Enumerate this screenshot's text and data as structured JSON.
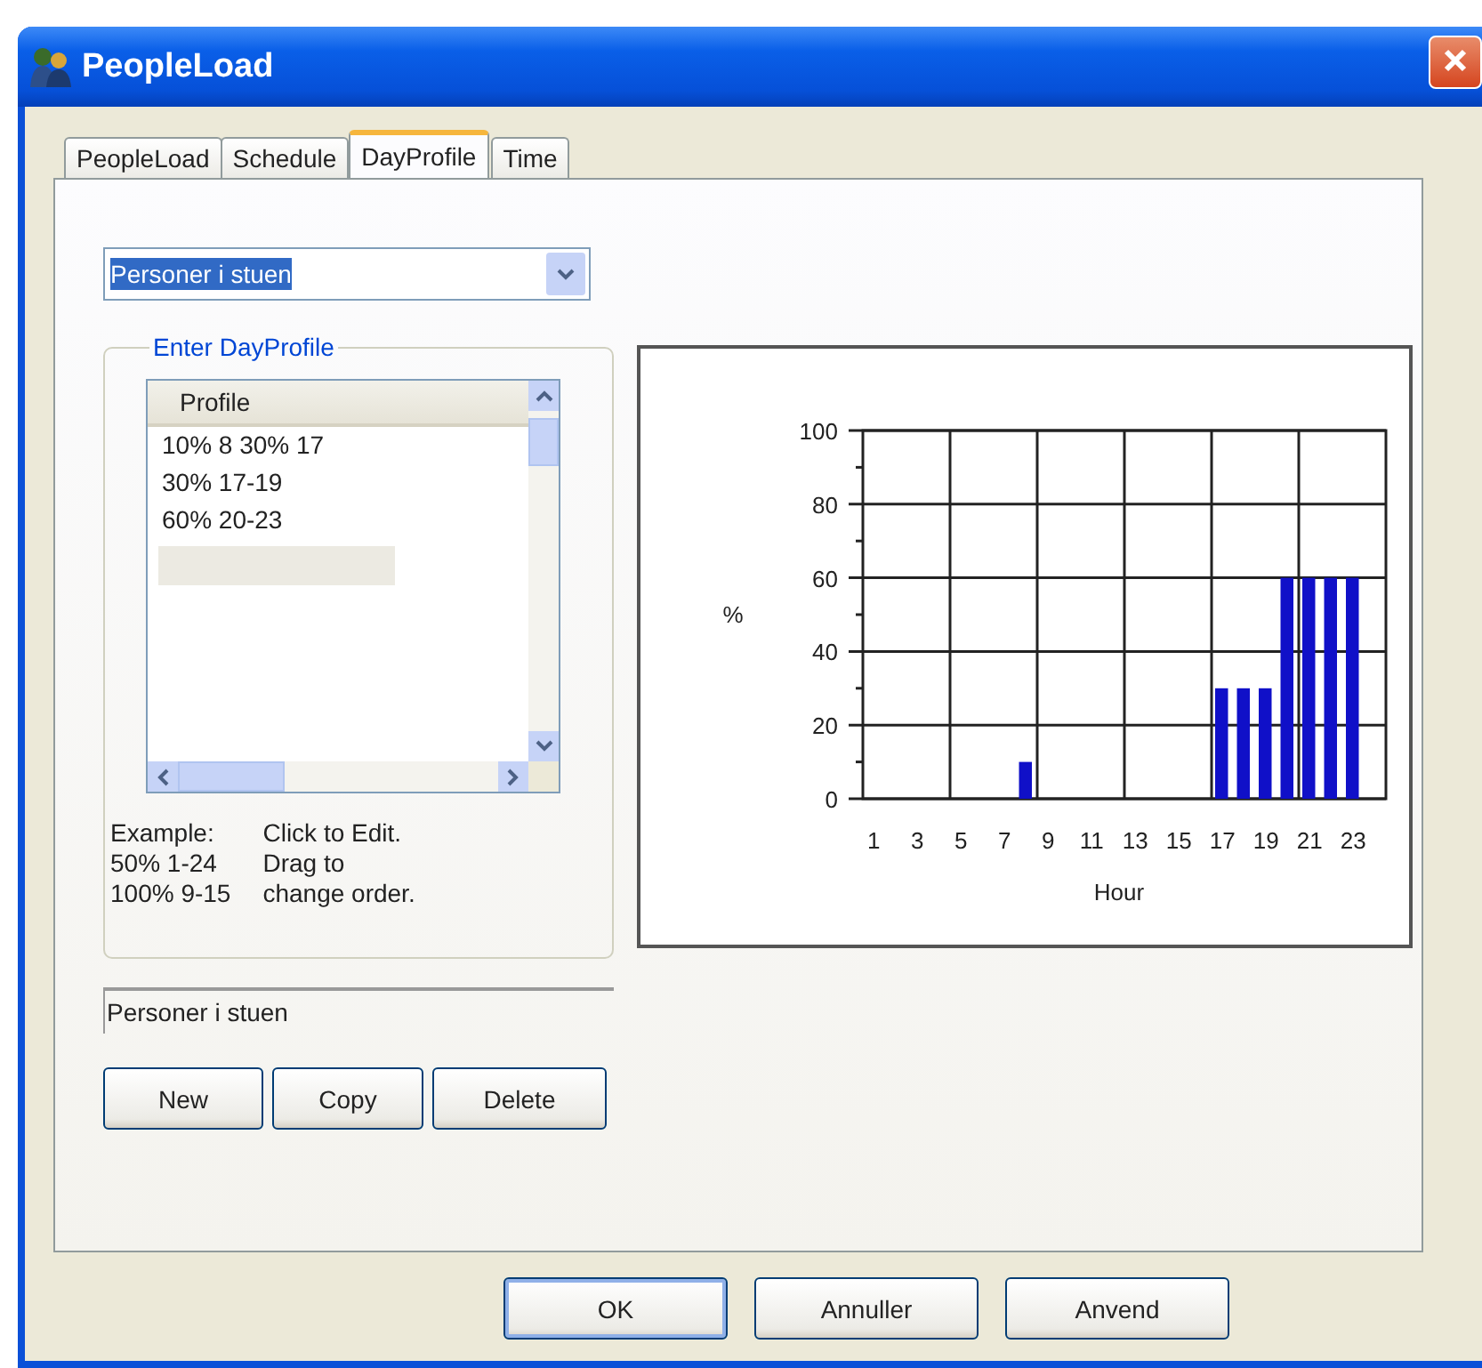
{
  "window": {
    "title": "PeopleLoad"
  },
  "tabs": [
    {
      "label": "PeopleLoad",
      "selected": false
    },
    {
      "label": "Schedule",
      "selected": false
    },
    {
      "label": "DayProfile",
      "selected": true
    },
    {
      "label": "Time",
      "selected": false
    }
  ],
  "profile_select": {
    "value": "Personer i stuen"
  },
  "group": {
    "title": "Enter DayProfile",
    "list": {
      "header": "Profile",
      "rows": [
        "10% 8 30% 17",
        "30% 17-19",
        "60% 20-23"
      ]
    },
    "example": "Example:\n50% 1-24\n100% 9-15",
    "hint": "Click to Edit.\nDrag to\nchange order."
  },
  "name_field": {
    "value": "Personer i stuen"
  },
  "profile_buttons": [
    {
      "label": "New",
      "default": false
    },
    {
      "label": "Copy",
      "default": false
    },
    {
      "label": "Delete",
      "default": false
    }
  ],
  "chart": {
    "chart_data": {
      "type": "bar",
      "xlabel": "Hour",
      "ylabel": "%",
      "grid": true,
      "x": [
        8,
        17,
        18,
        19,
        20,
        21,
        22,
        23
      ],
      "xlim": [
        0.5,
        24.5
      ],
      "series": [
        {
          "color": "#1010c8",
          "values": [
            10,
            30,
            30,
            30,
            60,
            60,
            60,
            60
          ]
        }
      ],
      "ylim": [
        0,
        100
      ],
      "yticks": [
        0,
        20,
        40,
        60,
        80,
        100
      ],
      "xticks": [
        1,
        3,
        5,
        7,
        9,
        11,
        13,
        15,
        17,
        19,
        21,
        23
      ]
    }
  },
  "buttons": [
    {
      "label": "OK",
      "default": true
    },
    {
      "label": "Annuller",
      "default": false
    },
    {
      "label": "Anvend",
      "default": false
    }
  ]
}
